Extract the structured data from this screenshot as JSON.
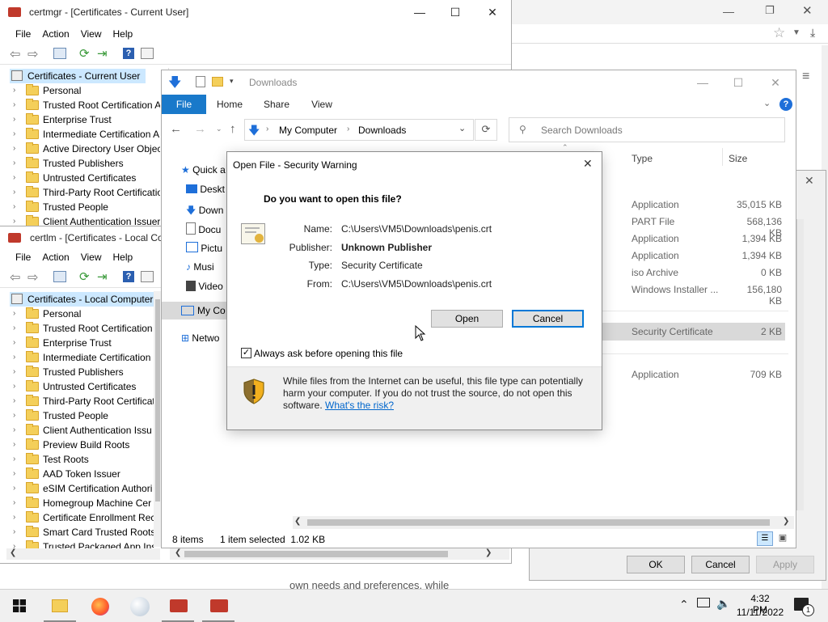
{
  "certmgr": {
    "title": "certmgr - [Certificates - Current User]",
    "menu": [
      "File",
      "Action",
      "View",
      "Help"
    ],
    "root": "Certificates - Current User",
    "items": [
      "Personal",
      "Trusted Root Certification A",
      "Enterprise Trust",
      "Intermediate Certification A",
      "Active Directory User Object",
      "Trusted Publishers",
      "Untrusted Certificates",
      "Third-Party Root Certificatio",
      "Trusted People",
      "Client Authentication Issuer"
    ]
  },
  "certlm": {
    "title": "certlm - [Certificates - Local Co",
    "menu": [
      "File",
      "Action",
      "View",
      "Help"
    ],
    "root": "Certificates - Local Computer",
    "items": [
      "Personal",
      "Trusted Root Certification",
      "Enterprise Trust",
      "Intermediate Certification",
      "Trusted Publishers",
      "Untrusted Certificates",
      "Third-Party Root Certificat",
      "Trusted People",
      "Client Authentication Issu",
      "Preview Build Roots",
      "Test Roots",
      "AAD Token Issuer",
      "eSIM Certification Authori",
      "Homegroup Machine Cer",
      "Certificate Enrollment Rec",
      "Smart Card Trusted Roots",
      "Trusted Packaged App Ins"
    ]
  },
  "explorer": {
    "title": "Downloads",
    "tabs": [
      "File",
      "Home",
      "Share",
      "View"
    ],
    "breadcrumb": [
      "My Computer",
      "Downloads"
    ],
    "search_placeholder": "Search Downloads",
    "nav": [
      "Quick a",
      "Deskt",
      "Down",
      "Docu",
      "Pictu",
      "Musi",
      "Video",
      "My Co",
      "Netwo"
    ],
    "columns": {
      "type": "Type",
      "size": "Size"
    },
    "rows": [
      {
        "type": "Application",
        "size": "35,015 KB"
      },
      {
        "type": "PART File",
        "size": "568,136 KB"
      },
      {
        "type": "Application",
        "size": "1,394 KB"
      },
      {
        "type": "Application",
        "size": "1,394 KB"
      },
      {
        "type": "iso Archive",
        "size": "0 KB"
      },
      {
        "type": "Windows Installer ...",
        "size": "156,180 KB"
      },
      {
        "type": "Security Certificate",
        "size": "2 KB"
      },
      {
        "type": "Application",
        "size": "709 KB"
      }
    ],
    "status_items": "8 items",
    "status_selected": "1 item selected  1.02 KB"
  },
  "dialog": {
    "title": "Open File - Security Warning",
    "question": "Do you want to open this file?",
    "labels": {
      "name": "Name:",
      "publisher": "Publisher:",
      "type": "Type:",
      "from": "From:"
    },
    "values": {
      "name": "C:\\Users\\VM5\\Downloads\\penis.crt",
      "publisher": "Unknown Publisher",
      "type": "Security Certificate",
      "from": "C:\\Users\\VM5\\Downloads\\penis.crt"
    },
    "open_label": "Open",
    "cancel_label": "Cancel",
    "checkbox_label": "Always ask before opening this file",
    "checkbox_checked": true,
    "warning_text": "While files from the Internet can be useful, this file type can potentially harm your computer. If you do not trust the source, do not open this software.",
    "risk_link": "What's the risk?"
  },
  "background_dialog": {
    "ok_label": "OK",
    "cancel_label": "Cancel",
    "apply_label": "Apply"
  },
  "background_text": "own needs and preferences. while",
  "taskbar": {
    "time": "4:32 PM",
    "date": "11/11/2022",
    "notification_count": "1"
  },
  "colors": {
    "accent": "#0078d7",
    "selection": "#cce8ff",
    "link": "#0066cc"
  }
}
